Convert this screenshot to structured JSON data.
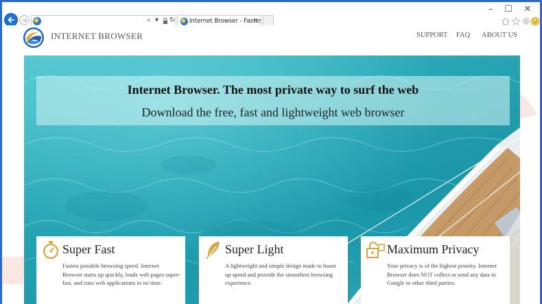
{
  "browser": {
    "tab_title": "Internet Browser - Fastest an...",
    "tab_close": "×",
    "window_controls": [
      "–",
      "☐",
      "✕"
    ],
    "address_tools": [
      "⌕",
      "▾",
      "🔒",
      "↻"
    ],
    "toolbar_icons": [
      "home-icon",
      "star-icon",
      "gear-icon",
      "smiley-icon"
    ]
  },
  "site": {
    "brand": "INTERNET BROWSER",
    "nav": [
      "SUPPORT",
      "FAQ",
      "ABOUT US"
    ]
  },
  "hero": {
    "title": "Internet Browser. The most private way to surf the web",
    "subtitle": "Download the free, fast and lightweight web browser"
  },
  "features": [
    {
      "icon": "stopwatch-icon",
      "title": "Super Fast",
      "text": "Fastest possible browsing speed. Internet Browser starts up quickly, loads web pages super-fast, and runs web applications in no time."
    },
    {
      "icon": "feather-icon",
      "title": "Super Light",
      "text": "A lightweight and simple design made to boost up speed and provide the smoothest browsing experience."
    },
    {
      "icon": "lock-icon",
      "title": "Maximum Privacy",
      "text": "Your privacy is of the highest priority. Internet Browser does NOT collect or send any data to Google or other third parties."
    }
  ],
  "colors": {
    "frame": "#2a6ac4",
    "accent_gold": "#d9a441",
    "water": "#2aa8b6"
  }
}
